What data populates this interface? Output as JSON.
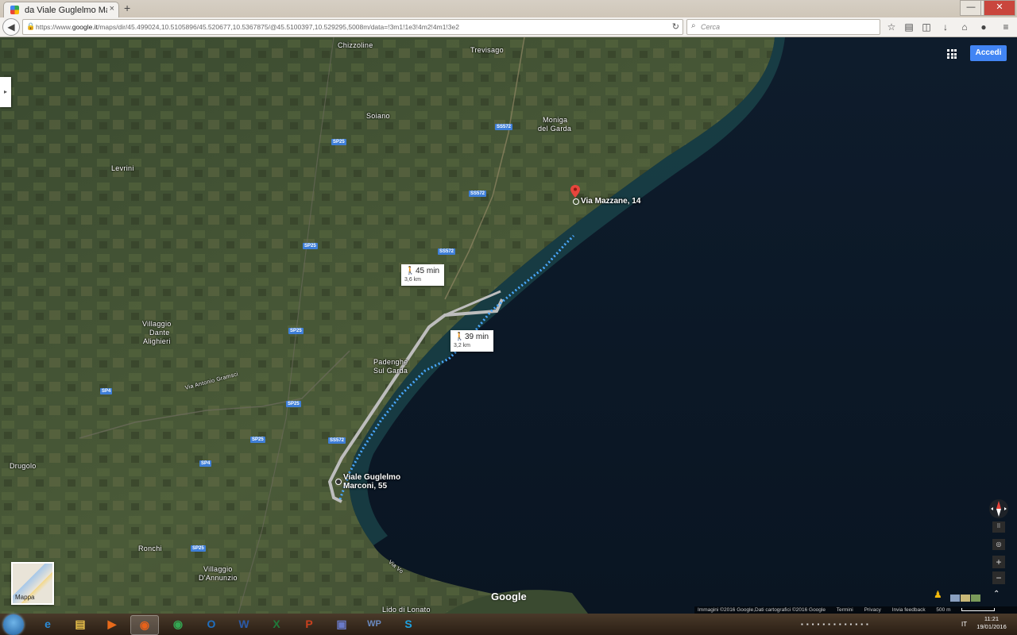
{
  "browser": {
    "tab_title": "da Viale Guglelmo Marconi...",
    "tab_close": "×",
    "new_tab": "+",
    "url_prefix": "https://www.",
    "url_domain": "google.it",
    "url_rest": "/maps/dir/45.499024,10.5105896/45.520677,10.5367875/@45.5100397,10.529295,5008m/data=!3m1!1e3!4m2!4m1!3e2",
    "search_placeholder": "Cerca",
    "win_min": "—",
    "win_max": "❐",
    "win_close": "✕"
  },
  "map": {
    "accedi_label": "Accedi",
    "sidebar_toggle": "▸",
    "places": [
      {
        "name": "Chizzoline"
      },
      {
        "name": "Trevisago"
      },
      {
        "name": "Soiano"
      },
      {
        "name": "Moniga"
      },
      {
        "name": "del Garda"
      },
      {
        "name": "Levrini"
      },
      {
        "name": "Villaggio"
      },
      {
        "name": "Dante"
      },
      {
        "name": "Alighieri"
      },
      {
        "name": "Padenghe"
      },
      {
        "name": "Sul Garda"
      },
      {
        "name": "Via Antonio Gramsci"
      },
      {
        "name": "Drugolo"
      },
      {
        "name": "Ronchi"
      },
      {
        "name": "Villaggio"
      },
      {
        "name": "D'Annunzio"
      },
      {
        "name": "Lido di Lonato"
      },
      {
        "name": "Via Vo"
      }
    ],
    "roads": [
      "SP25",
      "SS572",
      "SS572",
      "SS572",
      "SP25",
      "SP25",
      "SP4",
      "SP25",
      "SP25",
      "SP4",
      "SP25",
      "SS572"
    ],
    "destination_label": "Via Mazzane, 14",
    "origin_label_line1": "Viale Guglelmo",
    "origin_label_line2": "Marconi, 55",
    "route_alt": {
      "time": "45 min",
      "distance": "3,6 km"
    },
    "route_main": {
      "time": "39 min",
      "distance": "3,2 km"
    },
    "mappa_label": "Mappa",
    "google_logo": "Google",
    "footer": {
      "imagery": "Immagini ©2016 Google,Dati cartografici ©2016 Google",
      "terms": "Termini",
      "privacy": "Privacy",
      "feedback": "Invia feedback",
      "scale": "500 m"
    },
    "zoom_in": "+",
    "zoom_out": "−",
    "expand": "⌃"
  },
  "taskbar": {
    "apps": [
      {
        "name": "ie",
        "glyph": "e",
        "color": "#2a8ad6"
      },
      {
        "name": "explorer",
        "glyph": "▤",
        "color": "#e8c04a"
      },
      {
        "name": "media-player",
        "glyph": "▶",
        "color": "#e86a1a"
      },
      {
        "name": "firefox",
        "glyph": "◉",
        "color": "#e8621a"
      },
      {
        "name": "chrome",
        "glyph": "◉",
        "color": "#34a853"
      },
      {
        "name": "outlook",
        "glyph": "O",
        "color": "#1f6fc0"
      },
      {
        "name": "word",
        "glyph": "W",
        "color": "#2b5aa8"
      },
      {
        "name": "excel",
        "glyph": "X",
        "color": "#1f7a3a"
      },
      {
        "name": "powerpoint",
        "glyph": "P",
        "color": "#c9401e"
      },
      {
        "name": "app",
        "glyph": "▣",
        "color": "#6a7ac8"
      },
      {
        "name": "wordpad",
        "glyph": "WP",
        "color": "#6a8ac0"
      },
      {
        "name": "skype",
        "glyph": "S",
        "color": "#1ea1e0"
      }
    ],
    "lang": "IT",
    "time": "11:21",
    "date": "19/01/2016"
  }
}
